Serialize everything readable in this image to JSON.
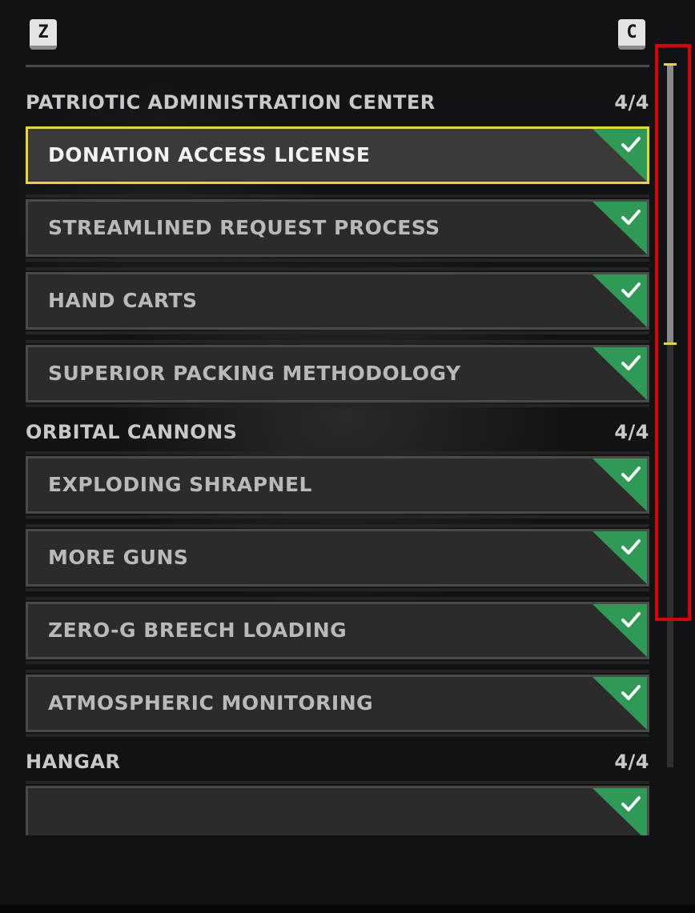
{
  "hotkeys": {
    "left": "Z",
    "right": "C"
  },
  "categories": [
    {
      "title": "PATRIOTIC ADMINISTRATION CENTER",
      "count": "4/4",
      "items": [
        {
          "label": "DONATION ACCESS LICENSE",
          "completed": true,
          "selected": true
        },
        {
          "label": "STREAMLINED REQUEST PROCESS",
          "completed": true
        },
        {
          "label": "HAND CARTS",
          "completed": true
        },
        {
          "label": "SUPERIOR PACKING METHODOLOGY",
          "completed": true
        }
      ]
    },
    {
      "title": "ORBITAL CANNONS",
      "count": "4/4",
      "items": [
        {
          "label": "EXPLODING SHRAPNEL",
          "completed": true
        },
        {
          "label": "MORE GUNS",
          "completed": true
        },
        {
          "label": "ZERO-G BREECH LOADING",
          "completed": true
        },
        {
          "label": "ATMOSPHERIC MONITORING",
          "completed": true
        }
      ]
    },
    {
      "title": "HANGAR",
      "count": "4/4",
      "items": [
        {
          "label": "",
          "completed": true
        }
      ]
    }
  ],
  "scrollbar": {
    "position_fraction": 0.0,
    "visible_fraction": 0.4
  },
  "colors": {
    "selected_border": "#e8d82a",
    "completed_badge": "#2e9a55",
    "highlight_box": "#e00000"
  }
}
